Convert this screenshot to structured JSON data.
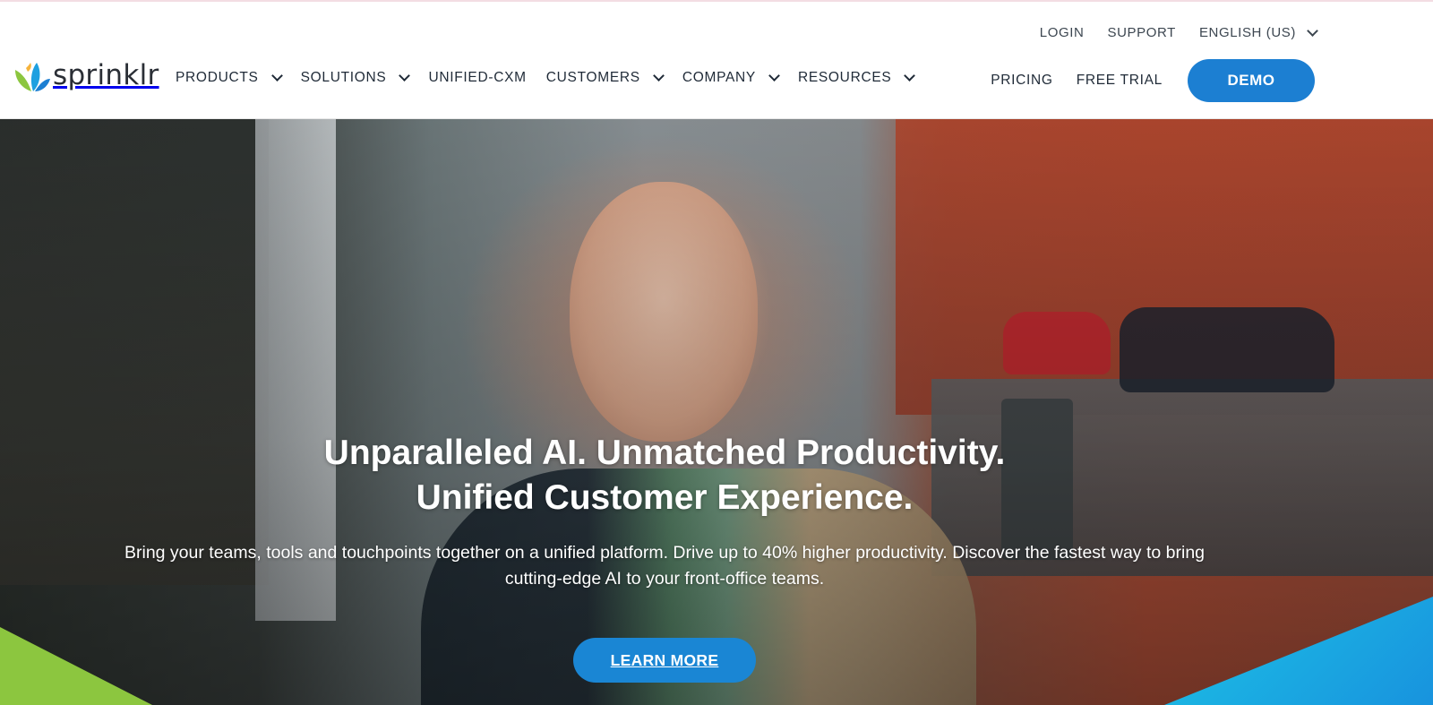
{
  "brand": {
    "name": "sprinklr",
    "colors": {
      "primary_blue": "#1c7fd2",
      "leaf_green": "#8cc63f",
      "leaf_blue": "#1ea0e0",
      "leaf_yellow": "#f6b33b"
    }
  },
  "utility_nav": {
    "login": "LOGIN",
    "support": "SUPPORT",
    "language": "ENGLISH (US)"
  },
  "main_nav": {
    "items": [
      {
        "label": "PRODUCTS",
        "has_dropdown": true
      },
      {
        "label": "SOLUTIONS",
        "has_dropdown": true
      },
      {
        "label": "UNIFIED-CXM",
        "has_dropdown": false
      },
      {
        "label": "CUSTOMERS",
        "has_dropdown": true
      },
      {
        "label": "COMPANY",
        "has_dropdown": true
      },
      {
        "label": "RESOURCES",
        "has_dropdown": true
      }
    ]
  },
  "right_nav": {
    "pricing": "PRICING",
    "free_trial": "FREE TRIAL",
    "demo": "DEMO"
  },
  "hero": {
    "title_line1": "Unparalleled AI. Unmatched Productivity.",
    "title_line2": "Unified Customer Experience.",
    "subtitle": "Bring your teams, tools and touchpoints together on a unified platform. Drive up to 40% higher productivity. Discover the fastest way to bring cutting-edge AI to your front-office teams.",
    "cta": "LEARN MORE"
  }
}
